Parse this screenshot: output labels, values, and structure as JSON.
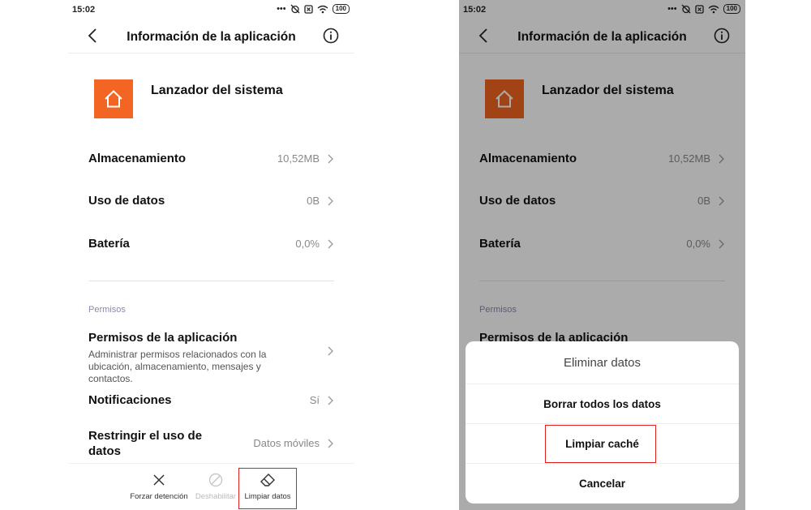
{
  "status_bar": {
    "time": "15:02",
    "battery": "100"
  },
  "header": {
    "title": "Información de la aplicación"
  },
  "app": {
    "name": "Lanzador del sistema",
    "icon": "home-icon",
    "icon_color": "#f26522"
  },
  "rows": [
    {
      "label": "Almacenamiento",
      "value": "10,52MB"
    },
    {
      "label": "Uso de datos",
      "value": "0B"
    },
    {
      "label": "Batería",
      "value": "0,0%"
    }
  ],
  "permissions": {
    "section_label": "Permisos",
    "title": "Permisos de la aplicación",
    "description": "Administrar permisos relacionados con la ubicación, almacenamiento, mensajes y contactos."
  },
  "notifications": {
    "label": "Notificaciones",
    "value": "Sí"
  },
  "restrict": {
    "label": "Restringir el uso de datos",
    "value": "Datos móviles"
  },
  "actions": {
    "force_stop": "Forzar detención",
    "disable": "Deshabilitar",
    "clear_data": "Limpiar datos"
  },
  "dialog": {
    "title": "Eliminar datos",
    "clear_all": "Borrar todos los datos",
    "clear_cache": "Limpiar caché",
    "cancel": "Cancelar"
  },
  "colors": {
    "highlight": "#e0201f",
    "accent": "#f26522"
  }
}
